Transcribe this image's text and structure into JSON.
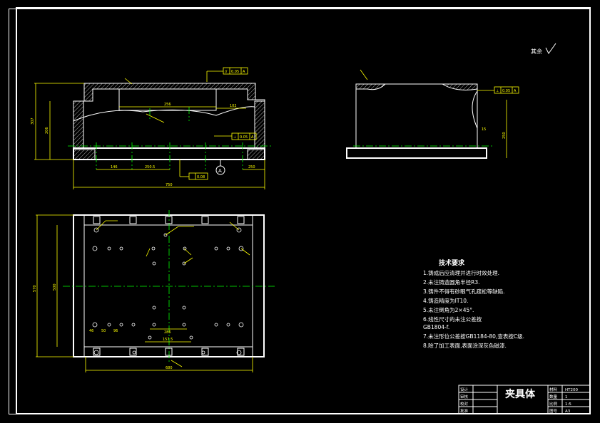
{
  "roughness_note": "其余",
  "tech_requirements": {
    "heading": "技术要求",
    "items": [
      "1.铸成后应清理并进行时效处理.",
      "2.未注铸造圆角半径R3.",
      "3.铸件不得有砂眼气孔疏松等缺陷.",
      "4.铸造精度为IT10.",
      "5.未注倒角为2×45°.",
      "6.线性尺寸的未注公差按",
      "GB1804-f.",
      "7.未注形位公差按GB1184-80,查表按C级.",
      "8.除了加工表面,表面涂深灰色磁漆."
    ]
  },
  "front_view": {
    "dimensions": {
      "inner_width": "256",
      "right_step": "102",
      "height_outer": "307",
      "height_inner": "206",
      "bottom_a": "146",
      "bottom_b": "250.5",
      "bottom_c": "250",
      "overall_width": "750",
      "ref_dim": "250"
    },
    "tolerances": {
      "top": [
        "//",
        "0.05",
        "A"
      ],
      "middle": [
        "⊥",
        "0.05",
        "A"
      ],
      "bottom": [
        "0.08"
      ]
    },
    "datum_label": "A"
  },
  "side_view": {
    "tolerance": [
      "⊥",
      "0.05",
      "A"
    ],
    "dim": "15",
    "height": "250"
  },
  "plan_view": {
    "dimensions": {
      "left_outer": "570",
      "left_inner": "500",
      "bottom_outer": "680",
      "bottom_inner": "157.5",
      "mid": "286",
      "s1": "46",
      "s2": "50",
      "s3": "96"
    }
  },
  "title_block": {
    "title": "夹具体",
    "left_labels": [
      "设计",
      "审核",
      "校对",
      "批准"
    ],
    "right_labels": [
      "材料",
      "数量",
      "比例",
      "图号"
    ],
    "right_values": [
      "HT200",
      "1",
      "1:5",
      "A3"
    ]
  }
}
